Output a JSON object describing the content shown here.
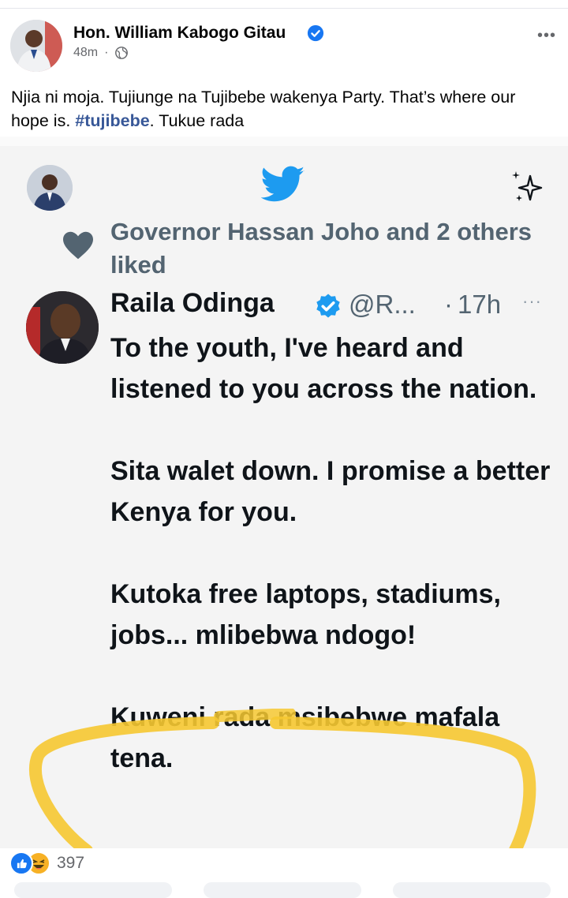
{
  "post": {
    "author_name": "Hon. William Kabogo Gitau",
    "time": "48m",
    "meta_separator": "·",
    "more_label": "•••",
    "text_before": "Njia ni moja. Tujiunge na Tujibebe wakenya Party. That’s where our hope is. ",
    "hashtag": "#tujibebe",
    "text_after": ". Tukue rada"
  },
  "tweet": {
    "liked_by": "Governor Hassan Joho and 2 others liked",
    "author_name": "Raila Odinga",
    "handle": "@R...",
    "dot": "·",
    "time": "17h",
    "more_label": "···",
    "paragraphs": [
      "To the youth, I've heard and listened to you across the nation.",
      "Sita walet down. I promise a better Kenya for you.",
      "Kutoka free laptops, stadiums, jobs... mlibebwa ndogo!",
      "Kuweni rada msibebwe mafala tena."
    ]
  },
  "footer": {
    "reaction_count": "397"
  },
  "colors": {
    "facebook_blue": "#1877f2",
    "hashtag_blue": "#385898",
    "twitter_blue": "#1d9bf0",
    "highlight_yellow": "#f6c831",
    "muted_gray": "#65676b"
  }
}
